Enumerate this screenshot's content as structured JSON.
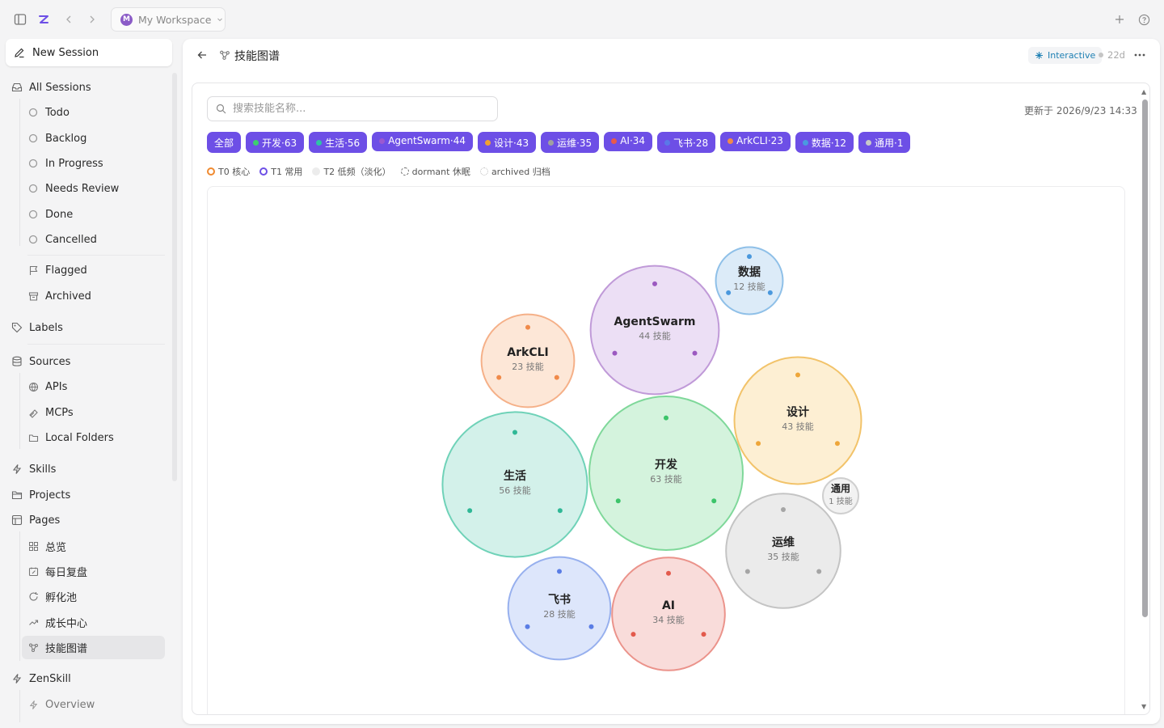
{
  "topbar": {
    "workspace_initial": "M",
    "workspace_name": "My Workspace",
    "icons": [
      "sidebar-toggle-icon",
      "app-logo-icon",
      "back-arrow-icon",
      "forward-arrow-icon",
      "plus-icon",
      "help-icon"
    ]
  },
  "sidebar": {
    "new_session": "New Session",
    "all_sessions": "All Sessions",
    "statuses": [
      "Todo",
      "Backlog",
      "In Progress",
      "Needs Review",
      "Done",
      "Cancelled"
    ],
    "flagged": "Flagged",
    "archived": "Archived",
    "labels": "Labels",
    "sources": "Sources",
    "source_items": [
      "APIs",
      "MCPs",
      "Local Folders"
    ],
    "skills": "Skills",
    "projects": "Projects",
    "pages": "Pages",
    "page_items": [
      "总览",
      "每日复盘",
      "孵化池",
      "成长中心",
      "技能图谱"
    ],
    "active_page": "技能图谱",
    "zenskill": "ZenSkill",
    "zenskill_items": [
      "Overview"
    ]
  },
  "header": {
    "title": "技能图谱",
    "badge": "Interactive",
    "age": "22d"
  },
  "content": {
    "search_placeholder": "搜索技能名称...",
    "updated": "更新于 2026/9/23 14:33",
    "chips": [
      {
        "label": "全部",
        "dot": null
      },
      {
        "label": "开发·63",
        "dot": "#3ccf6e"
      },
      {
        "label": "生活·56",
        "dot": "#2ec4a5"
      },
      {
        "label": "AgentSwarm·44",
        "dot": "#9b59d0"
      },
      {
        "label": "设计·43",
        "dot": "#f0a030"
      },
      {
        "label": "运维·35",
        "dot": "#a0a0a0"
      },
      {
        "label": "AI·34",
        "dot": "#e85a4a"
      },
      {
        "label": "飞书·28",
        "dot": "#5a78e8"
      },
      {
        "label": "ArkCLI·23",
        "dot": "#f08a4a"
      },
      {
        "label": "数据·12",
        "dot": "#4a9ae0"
      },
      {
        "label": "通用·1",
        "dot": "#c8c8c8"
      }
    ],
    "legend": [
      {
        "label": "T0 核心",
        "style": "t0"
      },
      {
        "label": "T1 常用",
        "style": "t1"
      },
      {
        "label": "T2 低频（淡化）",
        "style": "t2"
      },
      {
        "label": "dormant 休眠",
        "style": "dormant"
      },
      {
        "label": "archived 归档",
        "style": "archived"
      }
    ]
  },
  "chart_data": {
    "type": "bubble",
    "unit_label": "技能",
    "clusters": [
      {
        "name": "开发",
        "count": 63,
        "fill": "#d4f3dd",
        "stroke": "#7fd89a",
        "dot": "#3cc46a"
      },
      {
        "name": "生活",
        "count": 56,
        "fill": "#d3f1ea",
        "stroke": "#6fd2b8",
        "dot": "#2fb896"
      },
      {
        "name": "AgentSwarm",
        "count": 44,
        "fill": "#ecdff5",
        "stroke": "#c09ad8",
        "dot": "#9b59c0"
      },
      {
        "name": "设计",
        "count": 43,
        "fill": "#fdefd3",
        "stroke": "#f2c36a",
        "dot": "#eea63a"
      },
      {
        "name": "运维",
        "count": 35,
        "fill": "#ebebeb",
        "stroke": "#c4c4c4",
        "dot": "#a5a5a5"
      },
      {
        "name": "AI",
        "count": 34,
        "fill": "#f9dcda",
        "stroke": "#eb938b",
        "dot": "#e35a4c"
      },
      {
        "name": "飞书",
        "count": 28,
        "fill": "#dde6fb",
        "stroke": "#97b0ee",
        "dot": "#5a7de5"
      },
      {
        "name": "ArkCLI",
        "count": 23,
        "fill": "#fde7d7",
        "stroke": "#f5b088",
        "dot": "#f08a4a"
      },
      {
        "name": "数据",
        "count": 12,
        "fill": "#dcebf8",
        "stroke": "#8fc0e8",
        "dot": "#4a98dd"
      },
      {
        "name": "通用",
        "count": 1,
        "fill": "#f2f2f2",
        "stroke": "#cfcfcf",
        "dot": "#bdbdbd"
      }
    ]
  }
}
